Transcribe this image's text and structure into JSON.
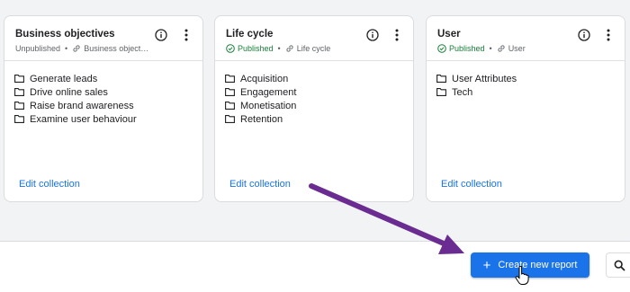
{
  "colors": {
    "accent": "#1a73e8",
    "published": "#188038",
    "arrow": "#6a2c91"
  },
  "cards": [
    {
      "title": "Business objectives",
      "status": "Unpublished",
      "link_label": "Business object…",
      "items": [
        "Generate leads",
        "Drive online sales",
        "Raise brand awareness",
        "Examine user behaviour"
      ],
      "edit_label": "Edit collection"
    },
    {
      "title": "Life cycle",
      "status": "Published",
      "link_label": "Life cycle",
      "items": [
        "Acquisition",
        "Engagement",
        "Monetisation",
        "Retention"
      ],
      "edit_label": "Edit collection"
    },
    {
      "title": "User",
      "status": "Published",
      "link_label": "User",
      "items": [
        "User Attributes",
        "Tech"
      ],
      "edit_label": "Edit collection"
    }
  ],
  "bottom": {
    "create_label": "Create new report"
  },
  "icons": [
    "info-icon",
    "more-vert-icon",
    "folder-icon",
    "link-icon",
    "check-circle-icon",
    "search-icon",
    "hand-cursor-icon",
    "annotation-arrow"
  ]
}
